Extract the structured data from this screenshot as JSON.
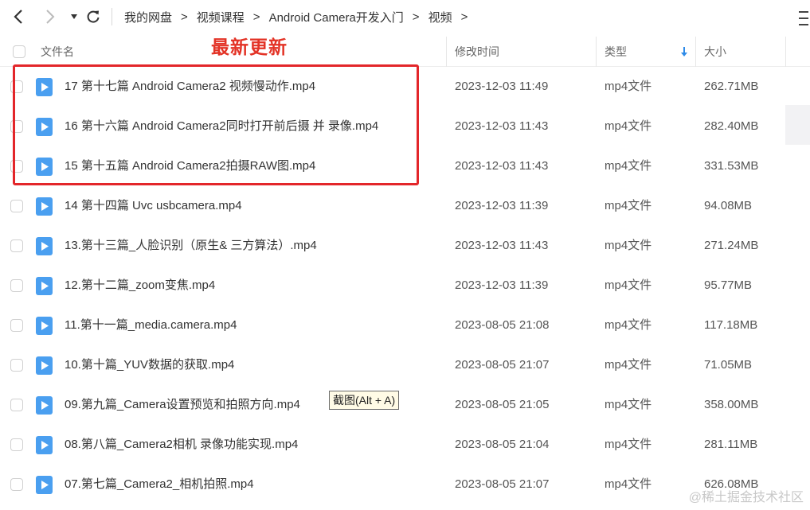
{
  "nav": {
    "back_icon": "chevron-left-icon",
    "forward_icon": "chevron-right-icon",
    "dropdown_icon": "triangle-down-icon",
    "refresh_icon": "refresh-icon",
    "menu_icon": "menu-icon"
  },
  "breadcrumb": [
    {
      "label": "我的网盘"
    },
    {
      "label": "视频课程"
    },
    {
      "label": "Android Camera开发入门"
    },
    {
      "label": "视频"
    }
  ],
  "breadcrumb_separator": ">",
  "columns": {
    "name": "文件名",
    "modified": "修改时间",
    "type": "类型",
    "size": "大小",
    "sort_icon": "arrow-down-icon"
  },
  "annotation": {
    "label": "最新更新",
    "color": "#e3262a"
  },
  "files": [
    {
      "name": "17 第十七篇 Android Camera2 视频慢动作.mp4",
      "modified": "2023-12-03 11:49",
      "type": "mp4文件",
      "size": "262.71MB"
    },
    {
      "name": "16 第十六篇 Android Camera2同时打开前后摄 并 录像.mp4",
      "modified": "2023-12-03 11:43",
      "type": "mp4文件",
      "size": "282.40MB"
    },
    {
      "name": "15 第十五篇  Android Camera2拍摄RAW图.mp4",
      "modified": "2023-12-03 11:43",
      "type": "mp4文件",
      "size": "331.53MB"
    },
    {
      "name": "14 第十四篇 Uvc usbcamera.mp4",
      "modified": "2023-12-03 11:39",
      "type": "mp4文件",
      "size": "94.08MB"
    },
    {
      "name": "13.第十三篇_人脸识别（原生& 三方算法）.mp4",
      "modified": "2023-12-03 11:43",
      "type": "mp4文件",
      "size": "271.24MB"
    },
    {
      "name": "12.第十二篇_zoom变焦.mp4",
      "modified": "2023-12-03 11:39",
      "type": "mp4文件",
      "size": "95.77MB"
    },
    {
      "name": "11.第十一篇_media.camera.mp4",
      "modified": "2023-08-05 21:08",
      "type": "mp4文件",
      "size": "117.18MB"
    },
    {
      "name": "10.第十篇_YUV数据的获取.mp4",
      "modified": "2023-08-05 21:07",
      "type": "mp4文件",
      "size": "71.05MB"
    },
    {
      "name": "09.第九篇_Camera设置预览和拍照方向.mp4",
      "modified": "2023-08-05 21:05",
      "type": "mp4文件",
      "size": "358.00MB"
    },
    {
      "name": "08.第八篇_Camera2相机 录像功能实现.mp4",
      "modified": "2023-08-05 21:04",
      "type": "mp4文件",
      "size": "281.11MB"
    },
    {
      "name": "07.第七篇_Camera2_相机拍照.mp4",
      "modified": "2023-08-05 21:07",
      "type": "mp4文件",
      "size": "626.08MB"
    }
  ],
  "file_icon": "video-file-icon",
  "tooltip": "截图(Alt + A)",
  "watermark": "@稀土掘金技术社区",
  "colors": {
    "file_icon": "#4a9ff0",
    "accent": "#2f8be8"
  }
}
